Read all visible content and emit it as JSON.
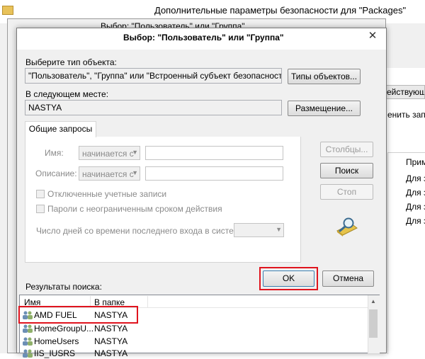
{
  "background_window": {
    "title": "Дополнительные параметры безопасности  для \"Packages\"",
    "tab_fragment": "ействующ",
    "text_fragment": "енить запи",
    "list_header_fragment": "Прим",
    "rows": [
      "Для з",
      "Для з",
      "Для з",
      "Для з"
    ]
  },
  "middle_dialog": {
    "title": "Выбор: \"Пользователь\" или \"Группа\""
  },
  "dialog": {
    "title": "Выбор: \"Пользователь\" или \"Группа\"",
    "close_label": "✕",
    "object_type_label": "Выберите тип объекта:",
    "object_type_value": "\"Пользователь\", \"Группа\" или \"Встроенный субъект безопасности\"",
    "object_types_button": "Типы объектов...",
    "location_label": "В следующем месте:",
    "location_value": "NASTYA",
    "locations_button": "Размещение...",
    "tab_common_queries": "Общие запросы",
    "name_label": "Имя:",
    "name_mode": "начинается с",
    "description_label": "Описание:",
    "description_mode": "начинается с",
    "disabled_accounts": "Отключенные учетные записи",
    "non_expiring_passwords": "Пароли с неограниченным сроком действия",
    "days_since_logon": "Число дней со времени последнего входа в систему:",
    "columns_button": "Столбцы...",
    "search_button": "Поиск",
    "stop_button": "Стоп",
    "ok_button": "OK",
    "cancel_button": "Отмена",
    "results_label": "Результаты поиска:",
    "results_columns": [
      "Имя",
      "В папке"
    ],
    "results": [
      {
        "name": "AMD FUEL",
        "folder": "NASTYA"
      },
      {
        "name": "HomeGroupU...",
        "folder": "NASTYA"
      },
      {
        "name": "HomeUsers",
        "folder": "NASTYA"
      },
      {
        "name": "IIS_IUSRS",
        "folder": "NASTYA"
      }
    ]
  },
  "colors": {
    "highlight": "#e0141e",
    "dialog_bg": "#f0f0f0"
  }
}
